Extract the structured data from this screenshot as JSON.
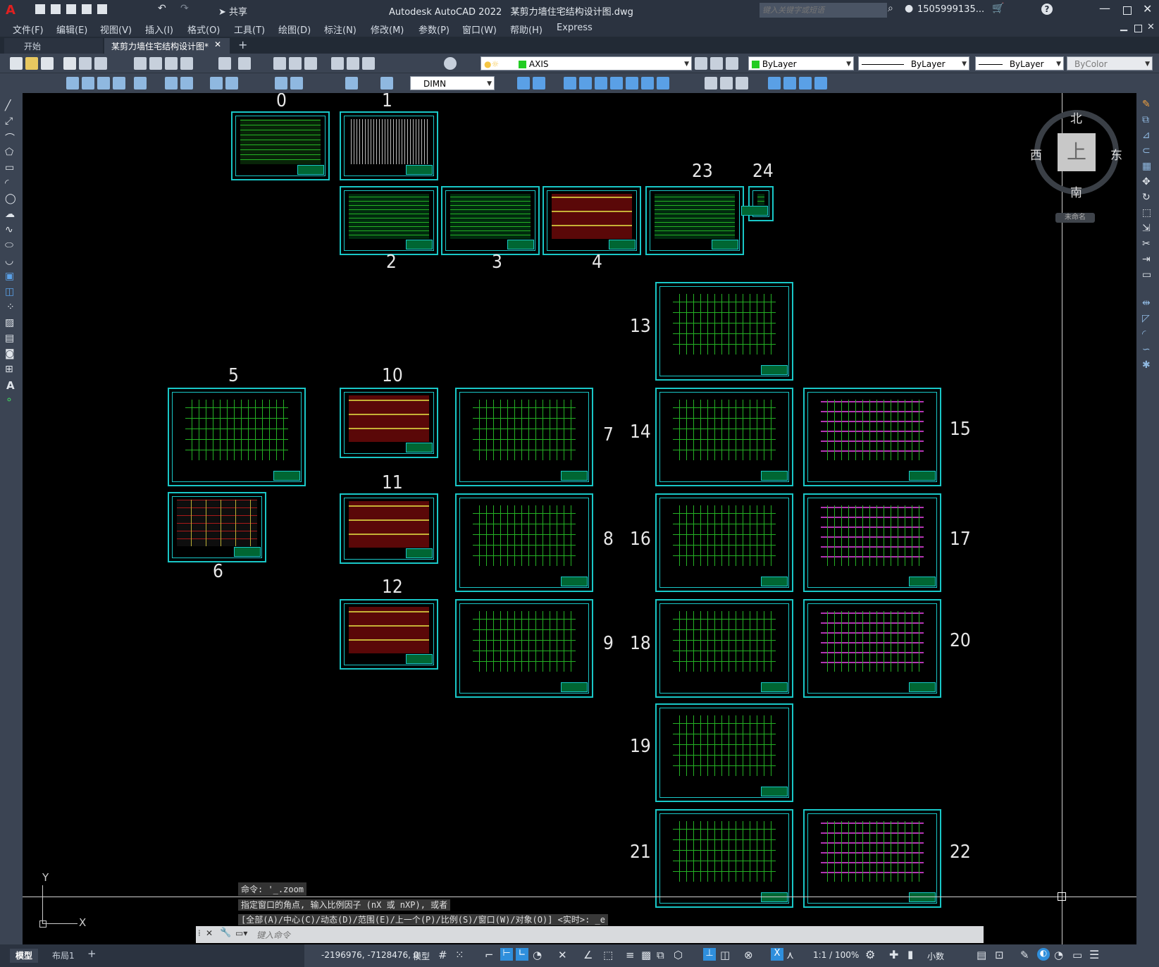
{
  "window": {
    "app_title": "Autodesk AutoCAD 2022",
    "file_title": "某剪力墙住宅结构设计图.dwg",
    "share_label": "共享",
    "search_placeholder": "键入关键字或短语",
    "user": "1505999135...",
    "help": "?"
  },
  "menu": [
    "文件(F)",
    "编辑(E)",
    "视图(V)",
    "插入(I)",
    "格式(O)",
    "工具(T)",
    "绘图(D)",
    "标注(N)",
    "修改(M)",
    "参数(P)",
    "窗口(W)",
    "帮助(H)",
    "Express"
  ],
  "tabs": {
    "start": "开始",
    "active": "某剪力墙住宅结构设计图*",
    "add": "+"
  },
  "toolbar": {
    "layer": "AXIS",
    "color": "ByLayer",
    "linetype": "ByLayer",
    "lineweight": "ByLayer",
    "plotstyle": "ByColor",
    "dimstyle": "DIMN"
  },
  "viewcube": {
    "north": "北",
    "south": "南",
    "east": "东",
    "west": "西",
    "top": "上",
    "wcs": "未命名"
  },
  "sheets": [
    "0",
    "1",
    "2",
    "3",
    "4",
    "5",
    "6",
    "7",
    "8",
    "9",
    "10",
    "11",
    "12",
    "13",
    "14",
    "15",
    "16",
    "17",
    "18",
    "19",
    "20",
    "21",
    "22",
    "23",
    "24"
  ],
  "ucs": {
    "x": "X",
    "y": "Y"
  },
  "command": {
    "history": [
      "命令: '_.zoom",
      "指定窗口的角点, 输入比例因子 (nX 或 nXP), 或者",
      "[全部(A)/中心(C)/动态(D)/范围(E)/上一个(P)/比例(S)/窗口(W)/对象(O)] <实时>: _e"
    ],
    "placeholder": "键入命令"
  },
  "layout_tabs": [
    "模型",
    "布局1",
    "+"
  ],
  "status": {
    "coords": "-2196976, -7128476, 0",
    "mode": "模型",
    "scale": "1:1 / 100%",
    "units": "小数"
  },
  "colors": {
    "frame": "#19c7c7",
    "green": "#2bd12b",
    "red": "#c81e1e",
    "layer_swatch": "#22cc22"
  }
}
